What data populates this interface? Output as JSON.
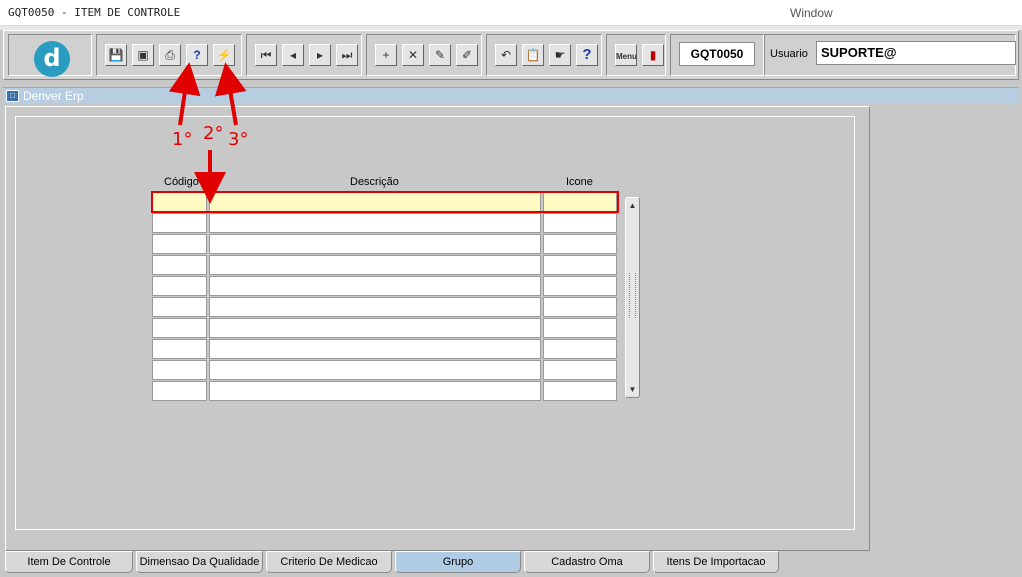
{
  "window": {
    "title": "GQT0050 - ITEM DE CONTROLE",
    "menu_window": "Window"
  },
  "toolbar": {
    "logo_letter": "d",
    "program_code": "GQT0050",
    "user_label": "Usuario",
    "user_value": "SUPORTE@",
    "buttons": [
      {
        "name": "save-icon",
        "glyph": "💾"
      },
      {
        "name": "screen-icon",
        "glyph": "▣"
      },
      {
        "name": "print-icon",
        "glyph": "⎙"
      },
      {
        "name": "enter-query-icon",
        "glyph": "?"
      },
      {
        "name": "execute-query-icon",
        "glyph": "⚡"
      },
      {
        "name": "first-record-icon",
        "glyph": "⏮"
      },
      {
        "name": "previous-record-icon",
        "glyph": "◂"
      },
      {
        "name": "next-record-icon",
        "glyph": "▸"
      },
      {
        "name": "last-record-icon",
        "glyph": "⏭"
      },
      {
        "name": "insert-record-icon",
        "glyph": "+"
      },
      {
        "name": "delete-record-icon",
        "glyph": "✕"
      },
      {
        "name": "edit-icon",
        "glyph": "✎"
      },
      {
        "name": "clear-icon",
        "glyph": "✐"
      },
      {
        "name": "undo-icon",
        "glyph": "↶"
      },
      {
        "name": "clipboard-icon",
        "glyph": "📋"
      },
      {
        "name": "hand-icon",
        "glyph": "☛"
      },
      {
        "name": "help-icon",
        "glyph": "?"
      },
      {
        "name": "menu-icon",
        "glyph": "Menu"
      },
      {
        "name": "exit-icon",
        "glyph": "▮"
      }
    ]
  },
  "frame": {
    "title": "Denver Erp"
  },
  "grid": {
    "headers": {
      "codigo": "Código",
      "descricao": "Descrição",
      "icone": "Icone"
    }
  },
  "annotations": {
    "first": "1°",
    "second": "2°",
    "third": "3°",
    "color": "#e00000"
  },
  "tabs": [
    {
      "label": "Item De Controle",
      "active": false
    },
    {
      "label": "Dimensao Da Qualidade",
      "active": false
    },
    {
      "label": "Criterio De Medicao",
      "active": false
    },
    {
      "label": "Grupo",
      "active": true
    },
    {
      "label": "Cadastro Oma",
      "active": false
    },
    {
      "label": "Itens De Importacao",
      "active": false
    }
  ]
}
